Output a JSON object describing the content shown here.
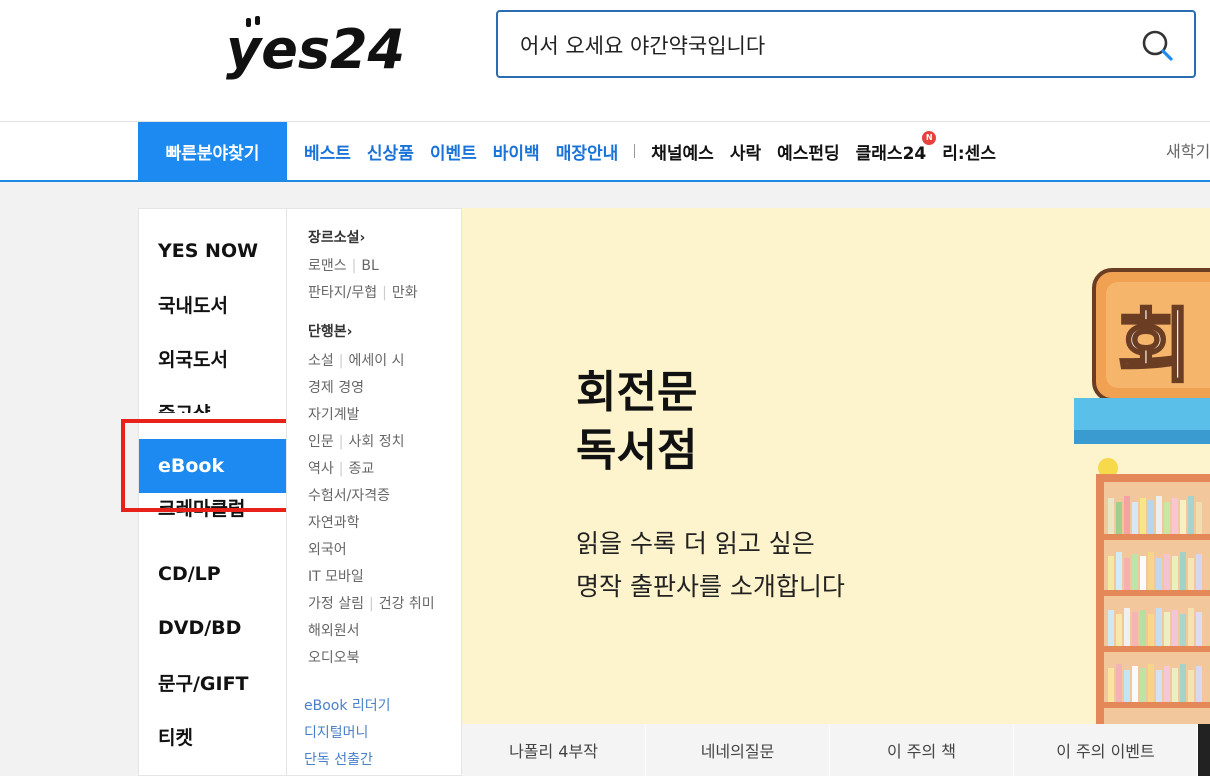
{
  "header": {
    "logo_text": "yes24",
    "search": {
      "value": "어서 오세요 야간약국입니다",
      "placeholder": ""
    }
  },
  "nav": {
    "quick_find": "빠른분야찾기",
    "links_blue": [
      "베스트",
      "신상품",
      "이벤트",
      "바이백",
      "매장안내"
    ],
    "links_dark": [
      "채널예스",
      "사락",
      "예스펀딩",
      "클래스24",
      "리:센스"
    ],
    "new_badge": "N",
    "right_text": "새학기"
  },
  "categories": [
    "YES NOW",
    "국내도서",
    "외국도서",
    "중고샵",
    "eBook",
    "크레마클럽",
    "CD/LP",
    "DVD/BD",
    "문구/GIFT",
    "티켓"
  ],
  "subcategories": {
    "genre_head": "장르소설",
    "genre_rows": [
      [
        "로맨스",
        "BL"
      ],
      [
        "판타지/무협",
        "만화"
      ]
    ],
    "single_head": "단행본",
    "single_rows": [
      [
        "소설",
        "에세이 시"
      ],
      [
        "경제 경영"
      ],
      [
        "자기계발"
      ],
      [
        "인문",
        "사회 정치"
      ],
      [
        "역사",
        "종교"
      ],
      [
        "수험서/자격증"
      ],
      [
        "자연과학"
      ],
      [
        "외국어"
      ],
      [
        "IT 모바일"
      ],
      [
        "가정 살림",
        "건강 취미"
      ],
      [
        "해외원서"
      ],
      [
        "오디오북"
      ]
    ],
    "extra_links": [
      "eBook 리더기",
      "디지털머니",
      "단독 선출간"
    ]
  },
  "banner": {
    "title_line1": "회전문",
    "title_line2": "독서점",
    "sub_line1": "읽을 수록 더 읽고 싶은",
    "sub_line2": "명작 출판사를 소개합니다",
    "sign_char": "회"
  },
  "tabs": [
    "나폴리 4부작",
    "네네의질문",
    "이 주의 책",
    "이 주의 이벤트"
  ],
  "colors": {
    "accent": "#1c8af0",
    "highlight_box": "#e8211b",
    "banner_bg": "#fdf3cc",
    "search_border": "#2b6cb0"
  }
}
